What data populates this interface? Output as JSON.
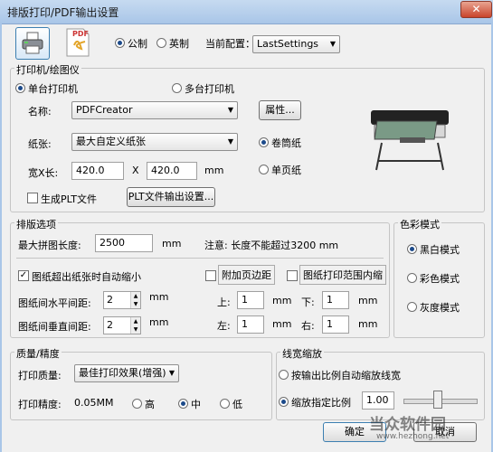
{
  "window": {
    "title": "排版打印/PDF输出设置",
    "close": "✕"
  },
  "top": {
    "metric": "公制",
    "imperial": "英制",
    "config_label": "当前配置：",
    "config_value": "LastSettings",
    "pdf_text": "PDF"
  },
  "printer": {
    "title": "打印机/绘图仪",
    "single": "单台打印机",
    "multi": "多台打印机",
    "name_label": "名称:",
    "name_value": "PDFCreator",
    "props_btn": "属性...",
    "paper_label": "纸张:",
    "paper_value": "最大自定义纸张",
    "roll": "卷筒纸",
    "sheet": "单页纸",
    "size_label": "宽X长:",
    "width": "420.0",
    "x": "X",
    "length": "420.0",
    "unit": "mm",
    "gen_plt": "生成PLT文件",
    "plt_btn": "PLT文件输出设置..."
  },
  "layout": {
    "title": "排版选项",
    "max_len_label": "最大拼图长度:",
    "max_len_value": "2500",
    "unit": "mm",
    "note": "注意: 长度不能超过3200 mm",
    "auto_shrink": "图纸超出纸张时自动缩小",
    "add_margin": "附加页边距",
    "shrink_range": "图纸打印范围内缩",
    "h_spacing_label": "图纸间水平间距:",
    "h_spacing": "2",
    "v_spacing_label": "图纸间垂直间距:",
    "v_spacing": "2",
    "top_label": "上:",
    "top_val": "1",
    "bottom_label": "下:",
    "bottom_val": "1",
    "left_label": "左:",
    "left_val": "1",
    "right_label": "右:",
    "right_val": "1"
  },
  "color": {
    "title": "色彩模式",
    "bw": "黑白模式",
    "color": "彩色模式",
    "gray": "灰度模式"
  },
  "quality": {
    "title": "质量/精度",
    "quality_label": "打印质量:",
    "quality_value": "最佳打印效果(增强)",
    "precision_label": "打印精度:",
    "precision_value": "0.05MM",
    "high": "高",
    "mid": "中",
    "low": "低"
  },
  "lw": {
    "title": "线宽缩放",
    "by_ratio": "按输出比例自动缩放线宽",
    "fixed": "缩放指定比例",
    "fixed_value": "1.00"
  },
  "buttons": {
    "ok": "确定",
    "cancel": "取消"
  },
  "watermark": {
    "name": "当众软件园",
    "url": "www.hezhong.net"
  }
}
